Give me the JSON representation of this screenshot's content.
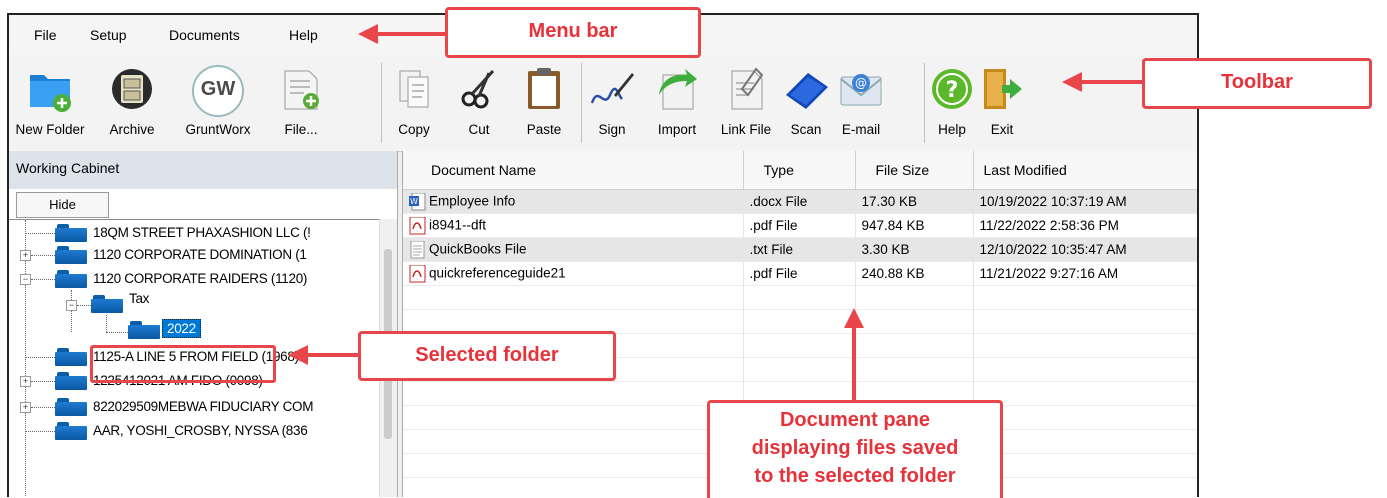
{
  "menu": [
    "File",
    "Setup",
    "Documents",
    "Help"
  ],
  "toolbar": {
    "new_folder": "New Folder",
    "archive": "Archive",
    "gruntworx": "GruntWorx",
    "file": "File...",
    "copy": "Copy",
    "cut": "Cut",
    "paste": "Paste",
    "sign": "Sign",
    "import": "Import",
    "link_file": "Link File",
    "scan": "Scan",
    "email": "E-mail",
    "help": "Help",
    "exit": "Exit",
    "gw_logo": "GW"
  },
  "left": {
    "header": "Working Cabinet",
    "hide_label": "Hide",
    "tree": [
      "18QM STREET PHAXASHION LLC (!",
      "1120 CORPORATE DOMINATION (1",
      "1120 CORPORATE RAIDERS (1120)",
      "Tax",
      "2022",
      "1125-A LINE 5 FROM FIELD (1968)",
      "1225412021 AM FIDO (0098)",
      "822029509MEBWA FIDUCIARY COM",
      "AAR, YOSHI_CROSBY, NYSSA (836"
    ]
  },
  "docs": {
    "columns": [
      "Document Name",
      "Type",
      "File Size",
      "Last Modified"
    ],
    "rows": [
      {
        "name": "Employee Info",
        "type": ".docx File",
        "size": "17.30 KB",
        "modified": "10/19/2022 10:37:19 AM",
        "icon": "word-icon"
      },
      {
        "name": "i8941--dft",
        "type": ".pdf File",
        "size": "947.84 KB",
        "modified": "11/22/2022 2:58:36 PM",
        "icon": "pdf-icon"
      },
      {
        "name": "QuickBooks File",
        "type": ".txt File",
        "size": "3.30 KB",
        "modified": "12/10/2022 10:35:47 AM",
        "icon": "text-file-icon"
      },
      {
        "name": "quickreferenceguide21",
        "type": ".pdf File",
        "size": "240.88 KB",
        "modified": "11/21/2022 9:27:16 AM",
        "icon": "pdf-icon"
      }
    ]
  },
  "annotations": {
    "menu_bar": "Menu bar",
    "toolbar": "Toolbar",
    "selected_folder": "Selected folder",
    "document_pane_1": "Document pane",
    "document_pane_2": "displaying files saved",
    "document_pane_3": "to the selected folder"
  },
  "colors": {
    "annotation": "#e8464a",
    "selection": "#0078d7",
    "folder": "#0a5fa8"
  }
}
